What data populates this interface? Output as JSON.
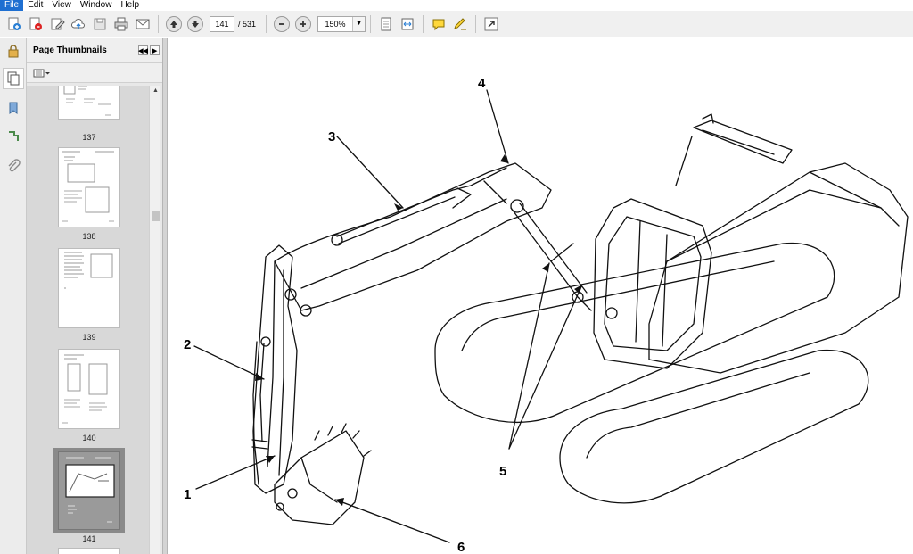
{
  "menu": {
    "items": [
      "File",
      "Edit",
      "View",
      "Window",
      "Help"
    ]
  },
  "toolbar": {
    "current_page": "141",
    "total_pages": "/ 531",
    "zoom": "150%"
  },
  "thumbnails": {
    "title": "Page Thumbnails",
    "pages": [
      {
        "label": "137"
      },
      {
        "label": "138"
      },
      {
        "label": "139"
      },
      {
        "label": "140"
      },
      {
        "label": "141"
      }
    ]
  },
  "drawing": {
    "callouts": [
      "1",
      "2",
      "3",
      "4",
      "5",
      "6"
    ]
  },
  "colors": {
    "menu_active": "#1e6fd1",
    "toolbar_bg": "#f0f0f0",
    "panel_bg": "#e8e8e8"
  },
  "icons": [
    "create-pdf-icon",
    "open-icon",
    "edit-icon",
    "cloud-icon",
    "save-icon",
    "print-icon",
    "email-icon",
    "previous-page-icon",
    "next-page-icon",
    "zoom-out-icon",
    "zoom-in-icon",
    "fit-page-icon",
    "fit-width-icon",
    "comment-icon",
    "highlight-icon",
    "expand-icon",
    "lock-icon",
    "pages-icon",
    "bookmark-icon",
    "layers-icon",
    "attachment-icon"
  ]
}
